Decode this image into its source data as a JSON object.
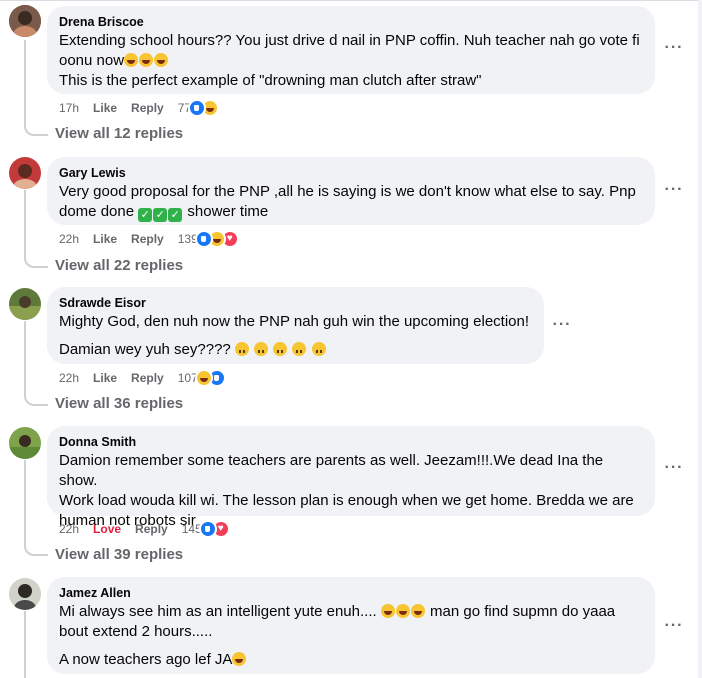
{
  "comments": [
    {
      "author": "Drena Briscoe",
      "lines": [
        "Extending school hours?? You just drive d nail in PNP coffin. Nuh teacher nah go vote fi",
        "oonu now"
      ],
      "line2": "This is the perfect example of \"drowning man clutch after straw\"",
      "time": "17h",
      "action": "Like",
      "reply": "Reply",
      "count": "77",
      "reactions": [
        "like",
        "haha"
      ],
      "view_replies": "View all 12 replies"
    },
    {
      "author": "Gary Lewis",
      "lines": [
        "Very good proposal for the PNP ,all he is saying is we don't know what else to say. Pnp",
        "dome done"
      ],
      "tail": "shower time",
      "time": "22h",
      "action": "Like",
      "reply": "Reply",
      "count": "139",
      "reactions": [
        "like",
        "haha",
        "love"
      ],
      "view_replies": "View all 22 replies"
    },
    {
      "author": "Sdrawde Eisor",
      "line1": "Mighty God, den nuh now the PNP nah guh win the upcoming election!",
      "line2": "Damian wey yuh sey????",
      "time": "22h",
      "action": "Like",
      "reply": "Reply",
      "count": "107",
      "reactions": [
        "haha",
        "like"
      ],
      "view_replies": "View all 36 replies"
    },
    {
      "author": "Donna Smith",
      "lines": [
        "Damion remember some teachers are parents as well. Jeezam!!!.We dead Ina the show.",
        "Work load wouda kill wi. The lesson plan is enough when we get home. Bredda we are",
        "human not robots sir"
      ],
      "time": "22h",
      "action": "Love",
      "reply": "Reply",
      "count": "145",
      "reactions": [
        "like",
        "love"
      ],
      "view_replies": "View all 39 replies"
    },
    {
      "author": "Jamez Allen",
      "line1a": "Mi always see him as an intelligent yute enuh....",
      "line1b": "man go find supmn do yaaa",
      "line1c": "bout extend 2 hours.....",
      "line2": "A now teachers ago lef JA"
    }
  ],
  "icons": {
    "more": "more-options-icon",
    "laugh": "laughing-emoji-icon",
    "check": "check-mark-emoji-icon",
    "upside": "upside-down-face-emoji-icon"
  },
  "more_glyph": "···"
}
